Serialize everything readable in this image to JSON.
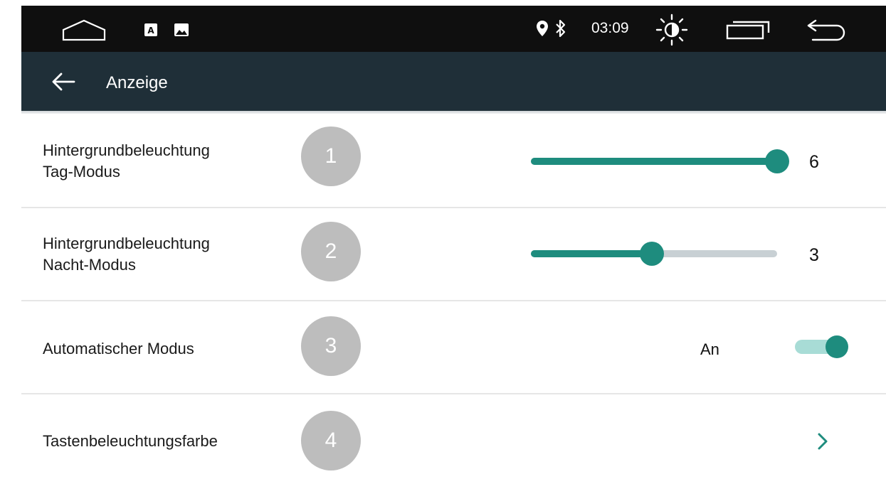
{
  "status_bar": {
    "time": "03:09",
    "icons": [
      "home-icon",
      "keyboard-a-icon",
      "gallery-icon",
      "location-icon",
      "bluetooth-icon",
      "brightness-icon",
      "recent-apps-icon",
      "return-icon"
    ],
    "background": "#0f0f0f"
  },
  "toolbar": {
    "title": "Anzeige",
    "background": "#1f2f38"
  },
  "settings": [
    {
      "number": "1",
      "label_line1": "Hintergrundbeleuchtung",
      "label_line2": "Tag-Modus",
      "value": "6",
      "level": 1.0
    },
    {
      "number": "2",
      "label_line1": "Hintergrundbeleuchtung",
      "label_line2": "Nacht-Modus",
      "value": "3",
      "level": 0.49
    },
    {
      "number": "3",
      "label": "Automatischer Modus",
      "state": "An",
      "toggle": "on"
    },
    {
      "number": "4",
      "label": "Tastenbeleuchtungsfarbe",
      "icon": "chevron-right-icon"
    }
  ],
  "colors": {
    "accent": "#1e8c7e",
    "track_inactive": "#c8d0d4",
    "toggle_track_on": "#a8dcd6",
    "badge": "#bdbdbd"
  }
}
